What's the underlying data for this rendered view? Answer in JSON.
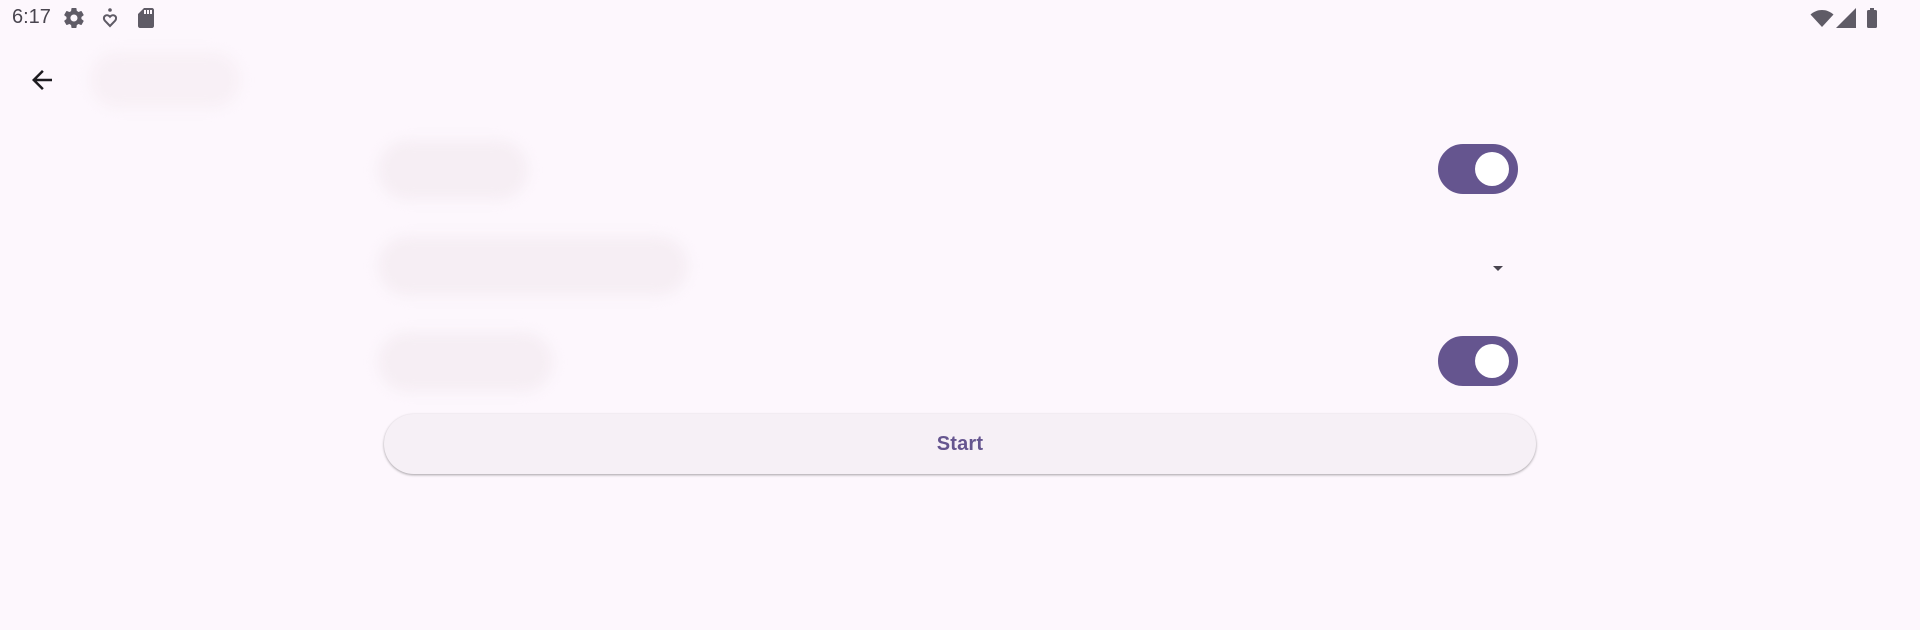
{
  "status_bar": {
    "time": "6:17",
    "left_icons": [
      "settings-gear-icon",
      "location-heart-icon",
      "sd-card-icon"
    ],
    "right_icons": [
      "wifi-icon",
      "cellular-signal-icon",
      "battery-icon"
    ]
  },
  "app_bar": {
    "back_icon": "arrow-back-icon",
    "title": ""
  },
  "settings": {
    "rows": [
      {
        "label": "",
        "control": "switch",
        "on": true
      },
      {
        "label": "",
        "control": "dropdown"
      },
      {
        "label": "",
        "control": "switch",
        "on": true
      }
    ]
  },
  "actions": {
    "start_label": "Start"
  },
  "colors": {
    "background": "#FDF7FD",
    "accent": "#65558F",
    "button_surface": "#F6F0F6",
    "icon": "#49454F"
  }
}
